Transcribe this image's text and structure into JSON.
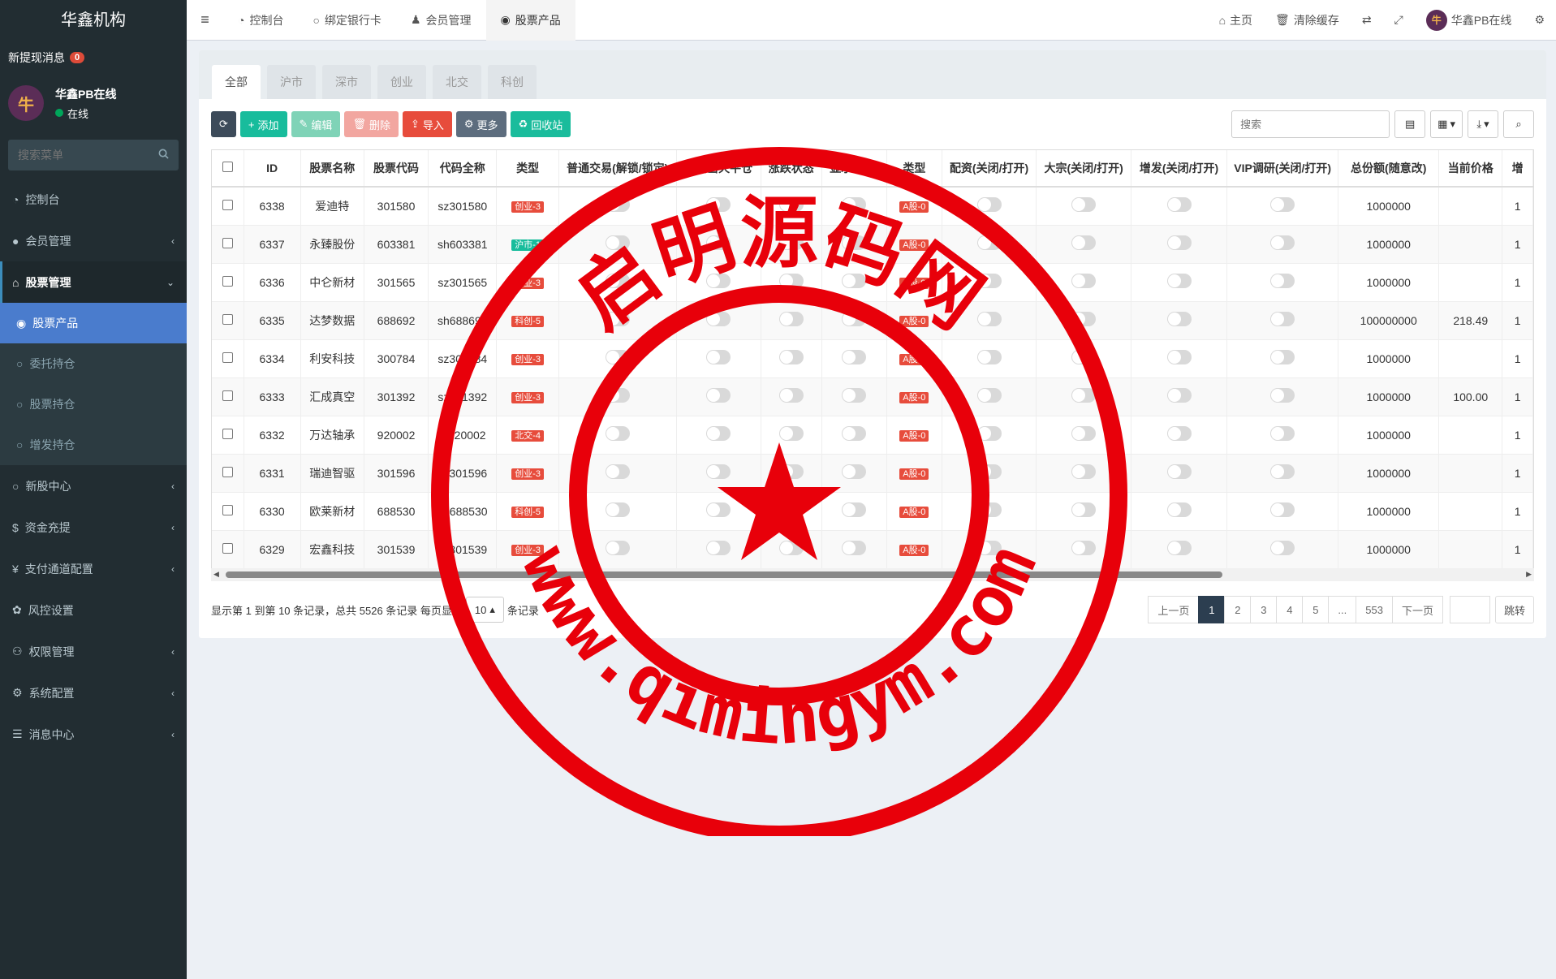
{
  "brand": "华鑫机构",
  "notice": {
    "label": "新提现消息",
    "count": "0"
  },
  "user": {
    "name": "华鑫PB在线",
    "status": "在线",
    "avatar_char": "牛"
  },
  "sidebar_search": {
    "placeholder": "搜索菜单"
  },
  "menu": {
    "dashboard": "控制台",
    "members": "会员管理",
    "stocks": "股票管理",
    "stock_sub": [
      "股票产品",
      "委托持仓",
      "股票持仓",
      "增发持仓"
    ],
    "ipo": "新股中心",
    "recharge": "资金充提",
    "payment": "支付通道配置",
    "risk": "风控设置",
    "perms": "权限管理",
    "system": "系统配置",
    "messages": "消息中心"
  },
  "top_tabs": [
    "控制台",
    "绑定银行卡",
    "会员管理",
    "股票产品"
  ],
  "top_right": {
    "home": "主页",
    "clear_cache": "清除缓存",
    "user": "华鑫PB在线"
  },
  "market_tabs": [
    "全部",
    "沪市",
    "深市",
    "创业",
    "北交",
    "科创"
  ],
  "toolbar": {
    "add": "添加",
    "edit": "编辑",
    "delete": "删除",
    "import": "导入",
    "more": "更多",
    "recycle": "回收站",
    "search_placeholder": "搜索"
  },
  "columns": [
    "ID",
    "股票名称",
    "股票代码",
    "代码全称",
    "类型",
    "普通交易(解锁/锁定)",
    "开启当天平仓",
    "涨跌状态",
    "显示/隐藏",
    "类型",
    "配资(关闭/打开)",
    "大宗(关闭/打开)",
    "增发(关闭/打开)",
    "VIP调研(关闭/打开)",
    "总份额(随意改)",
    "当前价格",
    "增"
  ],
  "rows": [
    {
      "id": "6338",
      "name": "爱迪特",
      "code": "301580",
      "full": "sz301580",
      "type": "创业-3",
      "type_color": "red",
      "type2": "A股-0",
      "total": "1000000",
      "price": "",
      "extra": "1"
    },
    {
      "id": "6337",
      "name": "永臻股份",
      "code": "603381",
      "full": "sh603381",
      "type": "沪市-1",
      "type_color": "green",
      "type2": "A股-0",
      "total": "1000000",
      "price": "",
      "extra": "1"
    },
    {
      "id": "6336",
      "name": "中仑新材",
      "code": "301565",
      "full": "sz301565",
      "type": "创业-3",
      "type_color": "red",
      "type2": "A股-0",
      "total": "1000000",
      "price": "",
      "extra": "1"
    },
    {
      "id": "6335",
      "name": "达梦数据",
      "code": "688692",
      "full": "sh688692",
      "type": "科创-5",
      "type_color": "red",
      "type2": "A股-0",
      "total": "100000000",
      "price": "218.49",
      "extra": "1"
    },
    {
      "id": "6334",
      "name": "利安科技",
      "code": "300784",
      "full": "sz300784",
      "type": "创业-3",
      "type_color": "red",
      "type2": "A股-0",
      "total": "1000000",
      "price": "",
      "extra": "1"
    },
    {
      "id": "6333",
      "name": "汇成真空",
      "code": "301392",
      "full": "sz301392",
      "type": "创业-3",
      "type_color": "red",
      "type2": "A股-0",
      "total": "1000000",
      "price": "100.00",
      "extra": "1"
    },
    {
      "id": "6332",
      "name": "万达轴承",
      "code": "920002",
      "full": "bj920002",
      "type": "北交-4",
      "type_color": "red",
      "type2": "A股-0",
      "total": "1000000",
      "price": "",
      "extra": "1"
    },
    {
      "id": "6331",
      "name": "瑞迪智驱",
      "code": "301596",
      "full": "sz301596",
      "type": "创业-3",
      "type_color": "red",
      "type2": "A股-0",
      "total": "1000000",
      "price": "",
      "extra": "1"
    },
    {
      "id": "6330",
      "name": "欧莱新材",
      "code": "688530",
      "full": "sh688530",
      "type": "科创-5",
      "type_color": "red",
      "type2": "A股-0",
      "total": "1000000",
      "price": "",
      "extra": "1"
    },
    {
      "id": "6329",
      "name": "宏鑫科技",
      "code": "301539",
      "full": "sz301539",
      "type": "创业-3",
      "type_color": "red",
      "type2": "A股-0",
      "total": "1000000",
      "price": "",
      "extra": "1"
    }
  ],
  "footer": {
    "summary": "显示第 1 到第 10 条记录，总共 5526 条记录 每页显示",
    "page_size": "10",
    "suffix": "条记录"
  },
  "pager": {
    "prev": "上一页",
    "pages": [
      "1",
      "2",
      "3",
      "4",
      "5",
      "...",
      "553"
    ],
    "next": "下一页",
    "jump": "跳转"
  },
  "watermark": {
    "top_text": "启明源码网",
    "bottom_text": "www.qimingym.com",
    "color": "#e8000a"
  }
}
